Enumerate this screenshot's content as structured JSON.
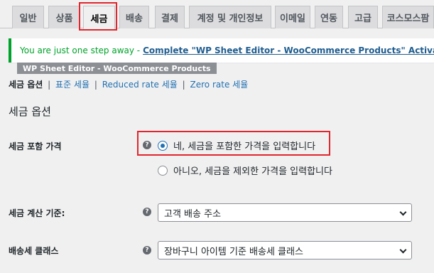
{
  "tabs": [
    {
      "label": "일반"
    },
    {
      "label": "상품"
    },
    {
      "label": "세금"
    },
    {
      "label": "배송"
    },
    {
      "label": "결제"
    },
    {
      "label": "계정 및 개인정보"
    },
    {
      "label": "이메일"
    },
    {
      "label": "연동"
    },
    {
      "label": "고급"
    },
    {
      "label": "코스모스팜"
    }
  ],
  "active_tab": "세금",
  "notice": {
    "text": "You are just one step away - ",
    "link": "Complete \"WP Sheet Editor - WooCommerce Products\" Activation Now",
    "color": "#00a32a"
  },
  "plugin_tag": "WP Sheet Editor - WooCommerce Products",
  "subsub": {
    "current": "세금 옵션",
    "links": [
      "표준 세율",
      "Reduced rate 세율",
      "Zero rate 세율"
    ],
    "separator": "|"
  },
  "section_title": "세금 옵션",
  "help_glyph": "?",
  "tax_inclusive": {
    "label": "세금 포함 가격",
    "options": [
      {
        "label": "네, 세금을 포함한 가격을 입력합니다",
        "checked": true
      },
      {
        "label": "아니오, 세금을 제외한 가격을 입력합니다",
        "checked": false
      }
    ]
  },
  "tax_based_on": {
    "label": "세금 계산 기준:",
    "value": "고객 배송 주소"
  },
  "shipping_tax_class": {
    "label": "배송세 클래스",
    "value": "장바구니 아이템 기준 배송세 클래스"
  },
  "colors": {
    "highlight": "#e1262d",
    "link": "#2271b1",
    "accent_radio": "#2271b1"
  }
}
